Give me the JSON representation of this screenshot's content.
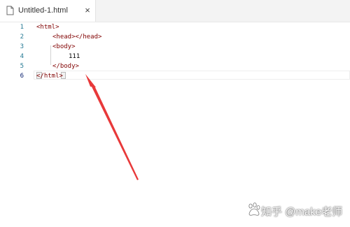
{
  "tab": {
    "title": "Untitled-1.html",
    "file_icon": "file-icon",
    "close_icon": "close-icon",
    "close_glyph": "×"
  },
  "editor": {
    "lines": [
      {
        "number": "1",
        "tag_open": "<html>",
        "text": ""
      },
      {
        "number": "2",
        "tag_open": "<head></head>",
        "text": ""
      },
      {
        "number": "3",
        "tag_open": "<body>",
        "text": ""
      },
      {
        "number": "4",
        "tag_open": "",
        "text": "111"
      },
      {
        "number": "5",
        "tag_open": "</body>",
        "text": ""
      },
      {
        "number": "6",
        "tag_open": "</html>",
        "text": ""
      }
    ],
    "active_line": "6"
  },
  "annotation": {
    "arrow_icon": "red-arrow-icon",
    "arrow_color": "#e8393a"
  },
  "watermark": {
    "text": "知乎 @make老师",
    "logo_icon": "baidu-paw-icon"
  },
  "colors": {
    "line_number": "#237893",
    "tag": "#800000",
    "text": "#000000"
  }
}
